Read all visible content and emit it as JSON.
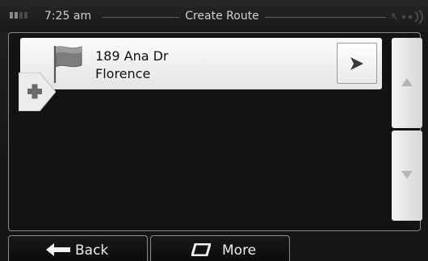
{
  "status_bar": {
    "time": "7:25 am",
    "title": "Create Route"
  },
  "route": {
    "items": [
      {
        "line1": "189 Ana Dr",
        "line2": "Florence",
        "icon": "flag-icon"
      }
    ]
  },
  "bottom_bar": {
    "back_label": "Back",
    "more_label": "More"
  },
  "colors": {
    "background": "#161616",
    "item_background": "#f0f0f0",
    "text_light": "#ededed",
    "text_dark": "#111111"
  }
}
